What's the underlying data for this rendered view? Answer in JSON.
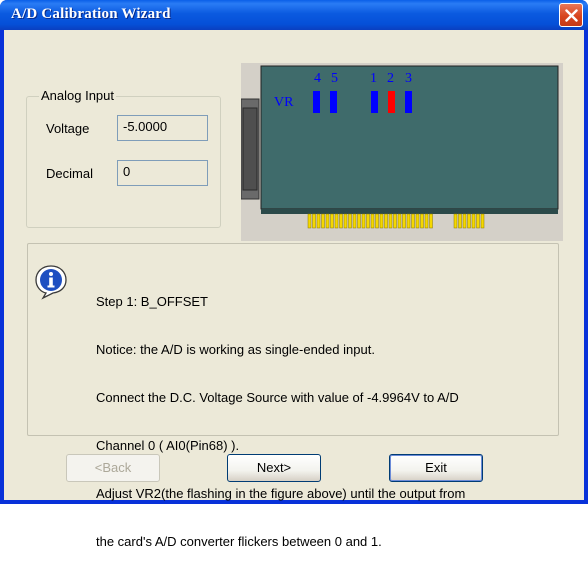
{
  "window": {
    "title": "A/D Calibration Wizard",
    "close_icon": "close-icon"
  },
  "analog_input": {
    "group_label": "Analog Input",
    "voltage_label": "Voltage",
    "voltage_value": "-5.0000",
    "decimal_label": "Decimal",
    "decimal_value": "0"
  },
  "card_figure": {
    "vr_label": "VR",
    "group_left_labels": [
      "4",
      "5"
    ],
    "group_right_labels": [
      "1",
      "2",
      "3"
    ],
    "flashing_vr": "2",
    "colors": {
      "board": "#3f6b6b",
      "vr": "#0000ff",
      "vr_active": "#ff0000",
      "pins": "#f5d800"
    }
  },
  "step": {
    "icon": "info-icon",
    "lines": [
      "Step 1: B_OFFSET",
      "Notice: the A/D is working as single-ended input.",
      "Connect the D.C. Voltage Source with value of -4.9964V to A/D",
      "Channel 0 ( AI0(Pin68) ).",
      "Adjust VR2(the flashing in the figure above) until the output from",
      "the card's A/D converter flickers between 0 and 1."
    ]
  },
  "buttons": {
    "back": "<Back",
    "next": "Next>",
    "exit": "Exit"
  }
}
